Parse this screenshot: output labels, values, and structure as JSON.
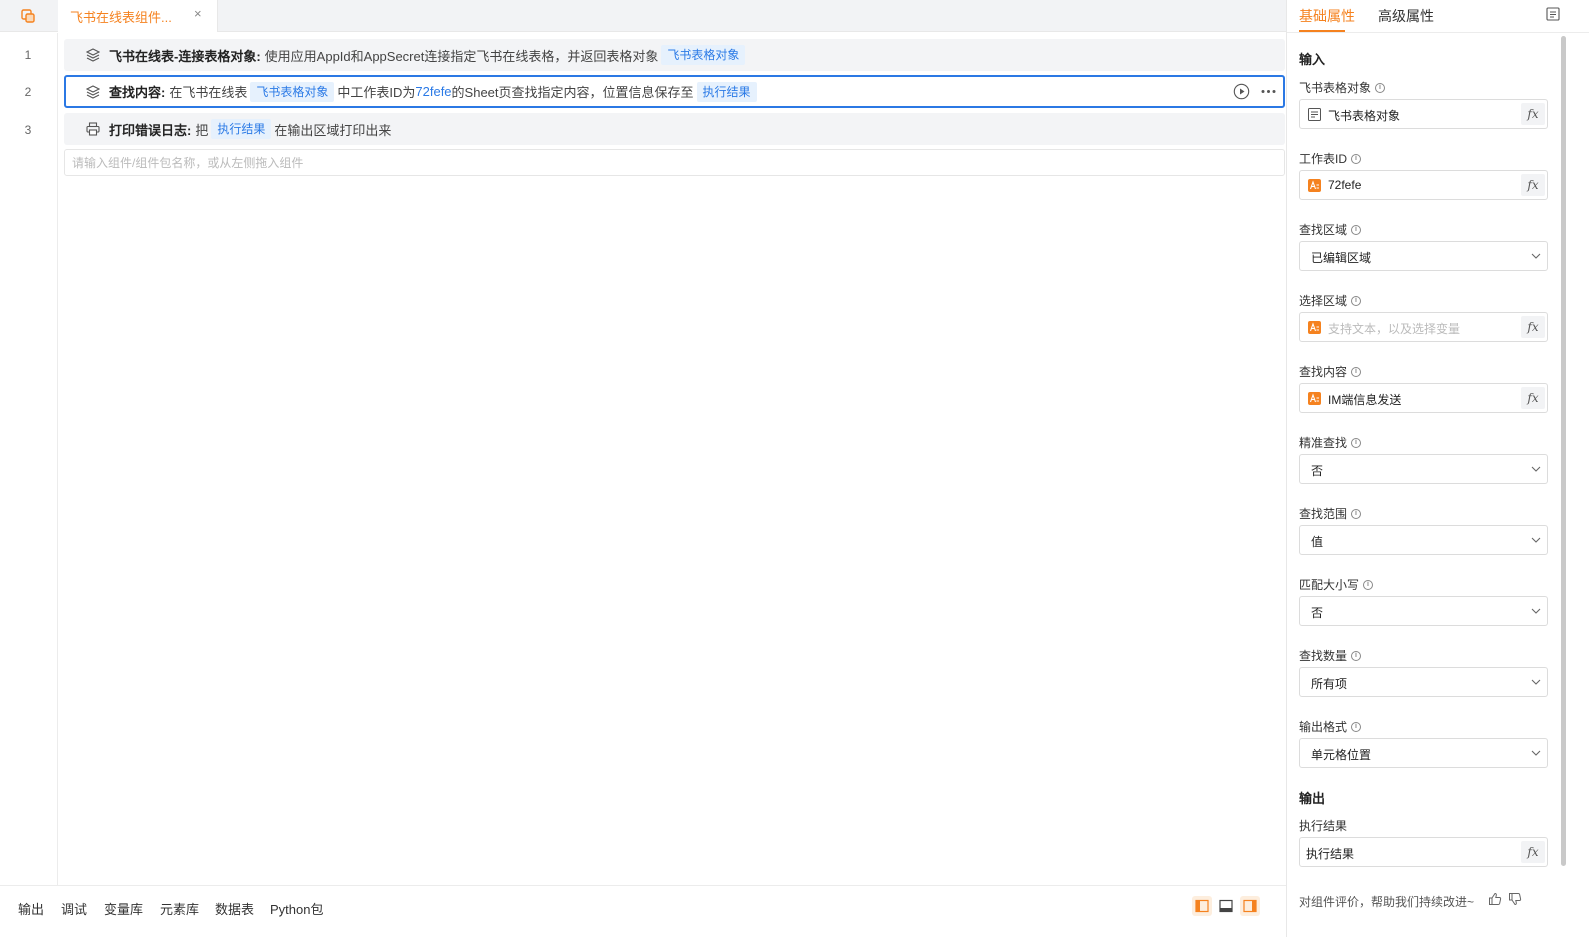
{
  "tabs": [
    {
      "label": "飞书在线表组件...",
      "close": "×"
    }
  ],
  "lines": [
    {
      "no": "1",
      "icon": "layers-icon",
      "title": "飞书在线表-连接表格对象:",
      "text": "使用应用AppId和AppSecret连接指定飞书在线表格，并返回表格对象",
      "chip": "飞书表格对象"
    },
    {
      "no": "2",
      "icon": "layers-icon",
      "title": "查找内容:",
      "text_1": "在飞书在线表",
      "chip_1": "飞书表格对象",
      "text_2": "中工作表ID为",
      "value": "72fefe",
      "text_3": "的Sheet页查找指定内容，位置信息保存至",
      "chip_2": "执行结果"
    },
    {
      "no": "3",
      "icon": "printer-icon",
      "title": "打印错误日志:",
      "text_1": "把",
      "chip": "执行结果",
      "text_2": "在输出区域打印出来"
    }
  ],
  "add_input": {
    "placeholder": "请输入组件/组件包名称，或从左侧拖入组件"
  },
  "bottom_tabs": [
    "输出",
    "调试",
    "变量库",
    "元素库",
    "数据表",
    "Python包"
  ],
  "panel": {
    "tabs": [
      "基础属性",
      "高级属性"
    ],
    "input_title": "输入",
    "output_title": "输出",
    "fields": [
      {
        "label": "飞书表格对象",
        "type": "var",
        "value": "飞书表格对象"
      },
      {
        "label": "工作表ID",
        "type": "text",
        "value": "72fefe"
      },
      {
        "label": "查找区域",
        "type": "select",
        "value": "已编辑区域"
      },
      {
        "label": "选择区域",
        "type": "text",
        "value": "",
        "placeholder": "支持文本，以及选择变量"
      },
      {
        "label": "查找内容",
        "type": "text",
        "value": "IM端信息发送"
      },
      {
        "label": "精准查找",
        "type": "select",
        "value": "否"
      },
      {
        "label": "查找范围",
        "type": "select",
        "value": "值"
      },
      {
        "label": "匹配大小写",
        "type": "select",
        "value": "否"
      },
      {
        "label": "查找数量",
        "type": "select",
        "value": "所有项"
      },
      {
        "label": "输出格式",
        "type": "select",
        "value": "单元格位置"
      }
    ],
    "output_field": {
      "label": "执行结果",
      "value": "执行结果"
    },
    "fx": "fx",
    "feedback": "对组件评价，帮助我们持续改进~"
  },
  "colors": {
    "accent": "#f5821f",
    "link": "#2b7ae6",
    "active_border": "#2b78e4"
  }
}
